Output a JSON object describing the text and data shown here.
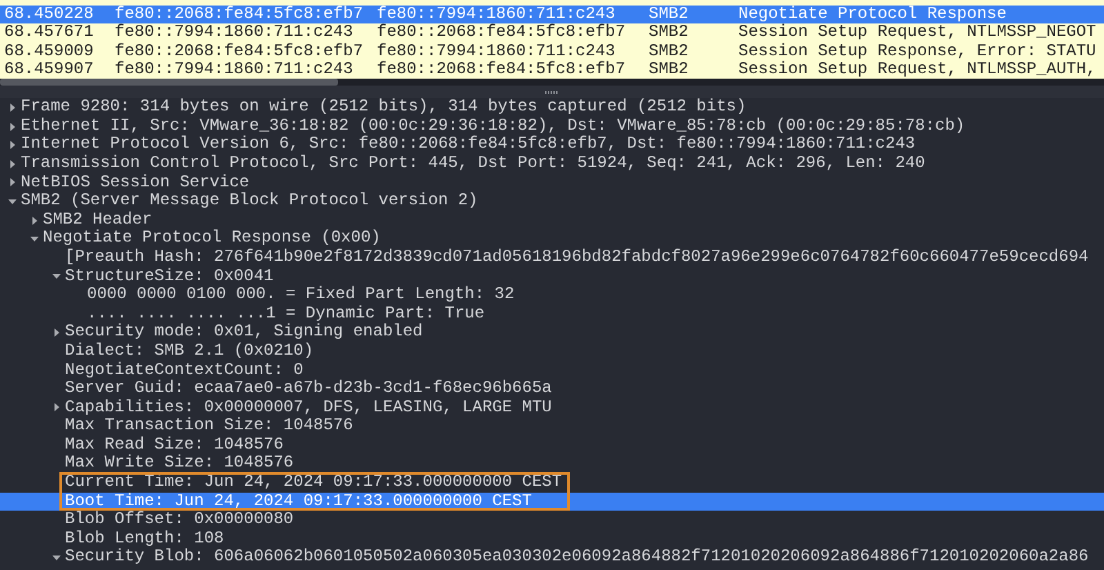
{
  "packet_list": {
    "rows": [
      {
        "time": "68.450228",
        "source": "fe80::2068:fe84:5fc8:efb7",
        "destination": "fe80::7994:1860:711:c243",
        "protocol": "SMB2",
        "info": "Negotiate Protocol Response",
        "selected": true
      },
      {
        "time": "68.457671",
        "source": "fe80::7994:1860:711:c243",
        "destination": "fe80::2068:fe84:5fc8:efb7",
        "protocol": "SMB2",
        "info": "Session Setup Request, NTLMSSP_NEGOT",
        "selected": false
      },
      {
        "time": "68.459009",
        "source": "fe80::2068:fe84:5fc8:efb7",
        "destination": "fe80::7994:1860:711:c243",
        "protocol": "SMB2",
        "info": "Session Setup Response, Error: STATU",
        "selected": false
      },
      {
        "time": "68.459907",
        "source": "fe80::7994:1860:711:c243",
        "destination": "fe80::2068:fe84:5fc8:efb7",
        "protocol": "SMB2",
        "info": "Session Setup Request, NTLMSSP_AUTH,",
        "selected": false
      }
    ]
  },
  "packet_details": [
    {
      "text": "Frame 9280: 314 bytes on wire (2512 bits), 314 bytes captured (2512 bits)",
      "expanded": false,
      "selected": false
    },
    {
      "text": "Ethernet II, Src: VMware_36:18:82 (00:0c:29:36:18:82), Dst: VMware_85:78:cb (00:0c:29:85:78:cb)",
      "expanded": false,
      "selected": false
    },
    {
      "text": "Internet Protocol Version 6, Src: fe80::2068:fe84:5fc8:efb7, Dst: fe80::7994:1860:711:c243",
      "expanded": false,
      "selected": false
    },
    {
      "text": "Transmission Control Protocol, Src Port: 445, Dst Port: 51924, Seq: 241, Ack: 296, Len: 240",
      "expanded": false,
      "selected": false
    },
    {
      "text": "NetBIOS Session Service",
      "expanded": false,
      "selected": false
    },
    {
      "text": "SMB2 (Server Message Block Protocol version 2)",
      "expanded": true,
      "selected": false,
      "children": [
        {
          "text": "SMB2 Header",
          "expanded": false,
          "selected": false
        },
        {
          "text": "Negotiate Protocol Response (0x00)",
          "expanded": true,
          "selected": false,
          "children": [
            {
              "text": "[Preauth Hash: 276f641b90e2f8172d3839cd071ad05618196bd82fabdcf8027a96e299e6c0764782f60c660477e59cecd694",
              "selected": false
            },
            {
              "text": "StructureSize: 0x0041",
              "expanded": true,
              "selected": false,
              "children": [
                {
                  "text": "0000 0000 0100 000. = Fixed Part Length: 32",
                  "selected": false
                },
                {
                  "text": ".... .... .... ...1 = Dynamic Part: True",
                  "selected": false
                }
              ]
            },
            {
              "text": "Security mode: 0x01, Signing enabled",
              "expanded": false,
              "selected": false
            },
            {
              "text": "Dialect: SMB 2.1 (0x0210)",
              "selected": false
            },
            {
              "text": "NegotiateContextCount: 0",
              "selected": false
            },
            {
              "text": "Server Guid: ecaa7ae0-a67b-d23b-3cd1-f68ec96b665a",
              "selected": false
            },
            {
              "text": "Capabilities: 0x00000007, DFS, LEASING, LARGE MTU",
              "expanded": false,
              "selected": false
            },
            {
              "text": "Max Transaction Size: 1048576",
              "selected": false
            },
            {
              "text": "Max Read Size: 1048576",
              "selected": false
            },
            {
              "text": "Max Write Size: 1048576",
              "selected": false
            },
            {
              "text": "Current Time: Jun 24, 2024 09:17:33.000000000 CEST",
              "selected": false,
              "highlighted": true
            },
            {
              "text": "Boot Time: Jun 24, 2024 09:17:33.000000000 CEST",
              "selected": true,
              "highlighted": true
            },
            {
              "text": "Blob Offset: 0x00000080",
              "selected": false
            },
            {
              "text": "Blob Length: 108",
              "selected": false
            },
            {
              "text": "Security Blob: 606a06062b0601050502a060305ea030302e06092a864882f71201020206092a864886f712010202060a2a86",
              "expanded": true,
              "selected": false
            }
          ]
        }
      ]
    }
  ]
}
